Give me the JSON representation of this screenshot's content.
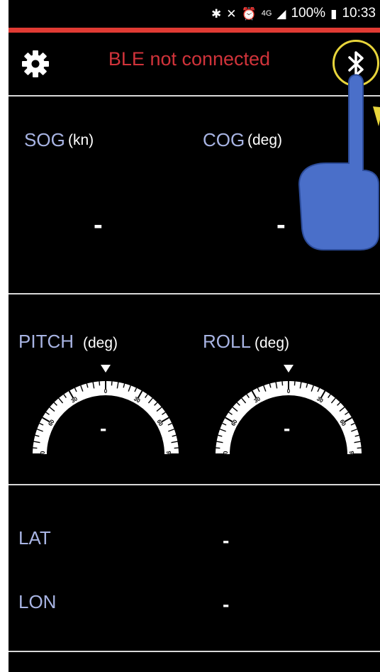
{
  "status_bar": {
    "battery": "100%",
    "time": "10:33",
    "network": "4G"
  },
  "app_bar": {
    "connection_status": "BLE not connected",
    "status_color": "#d0333a"
  },
  "sog": {
    "label": "SOG",
    "unit": "(kn)",
    "value": "-"
  },
  "cog": {
    "label": "COG",
    "unit": "(deg)",
    "value": "-"
  },
  "pitch": {
    "label": "PITCH",
    "unit": "(deg)",
    "value": "-"
  },
  "roll": {
    "label": "ROLL",
    "unit": "(deg)",
    "value": "-"
  },
  "gauge_scale": [
    "30",
    "0",
    "30",
    "60",
    "60",
    "90",
    "90"
  ],
  "lat": {
    "label": "LAT",
    "value": "-"
  },
  "lon": {
    "label": "LON",
    "value": "-"
  },
  "colors": {
    "accent_line": "#e13b34",
    "label_blue": "#a8b4e3",
    "bluetooth_highlight": "#e8d53b"
  }
}
